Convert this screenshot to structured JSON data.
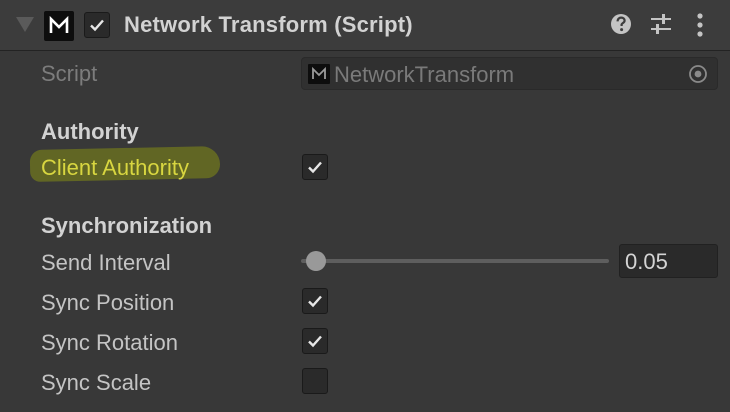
{
  "header": {
    "title": "Network Transform (Script)",
    "enabled": true,
    "script_icon": "mirror-script-icon",
    "help_icon": "help-icon",
    "presets_icon": "presets-sliders-icon",
    "menu_icon": "more-vertical-icon"
  },
  "script_field": {
    "label": "Script",
    "value": "NetworkTransform",
    "object_icon": "mirror-script-icon",
    "picker_icon": "object-picker-icon"
  },
  "authority": {
    "section_title": "Authority",
    "client_authority_label": "Client Authority",
    "client_authority": true,
    "highlight_color": "#848c14"
  },
  "synchronization": {
    "section_title": "Synchronization",
    "send_interval_label": "Send Interval",
    "send_interval": "0.05",
    "send_interval_slider_fraction": 0.05,
    "sync_position_label": "Sync Position",
    "sync_position": true,
    "sync_rotation_label": "Sync Rotation",
    "sync_rotation": true,
    "sync_scale_label": "Sync Scale",
    "sync_scale": false
  },
  "colors": {
    "background": "#383838",
    "header_background": "#3c3c3c",
    "text": "#c4c4c4",
    "disabled_text": "#7c7c7c",
    "checkbox_background": "#2a2a2a"
  }
}
